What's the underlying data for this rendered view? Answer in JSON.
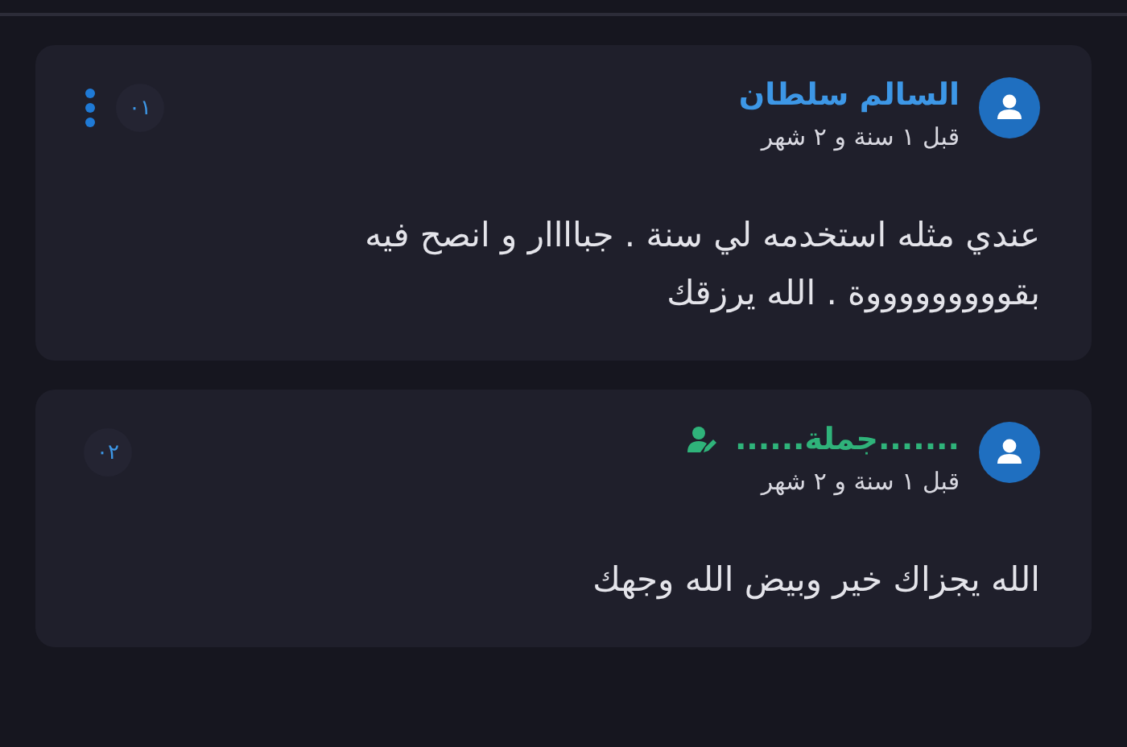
{
  "comments": [
    {
      "author": "السالم سلطان",
      "kind": "user",
      "time": "قبل ١ سنة و ٢ شهر",
      "text": "عندي مثله استخدمه لي سنة . جباااار و انصح فيه بقوووووووووة . الله يرزقك",
      "number": "٠١",
      "menu": true
    },
    {
      "author": ".......جملة......",
      "kind": "seller",
      "time": "قبل ١ سنة و ٢ شهر",
      "text": "الله يجزاك خير وبيض الله وجهك",
      "number": "٠٢",
      "menu": false
    }
  ]
}
